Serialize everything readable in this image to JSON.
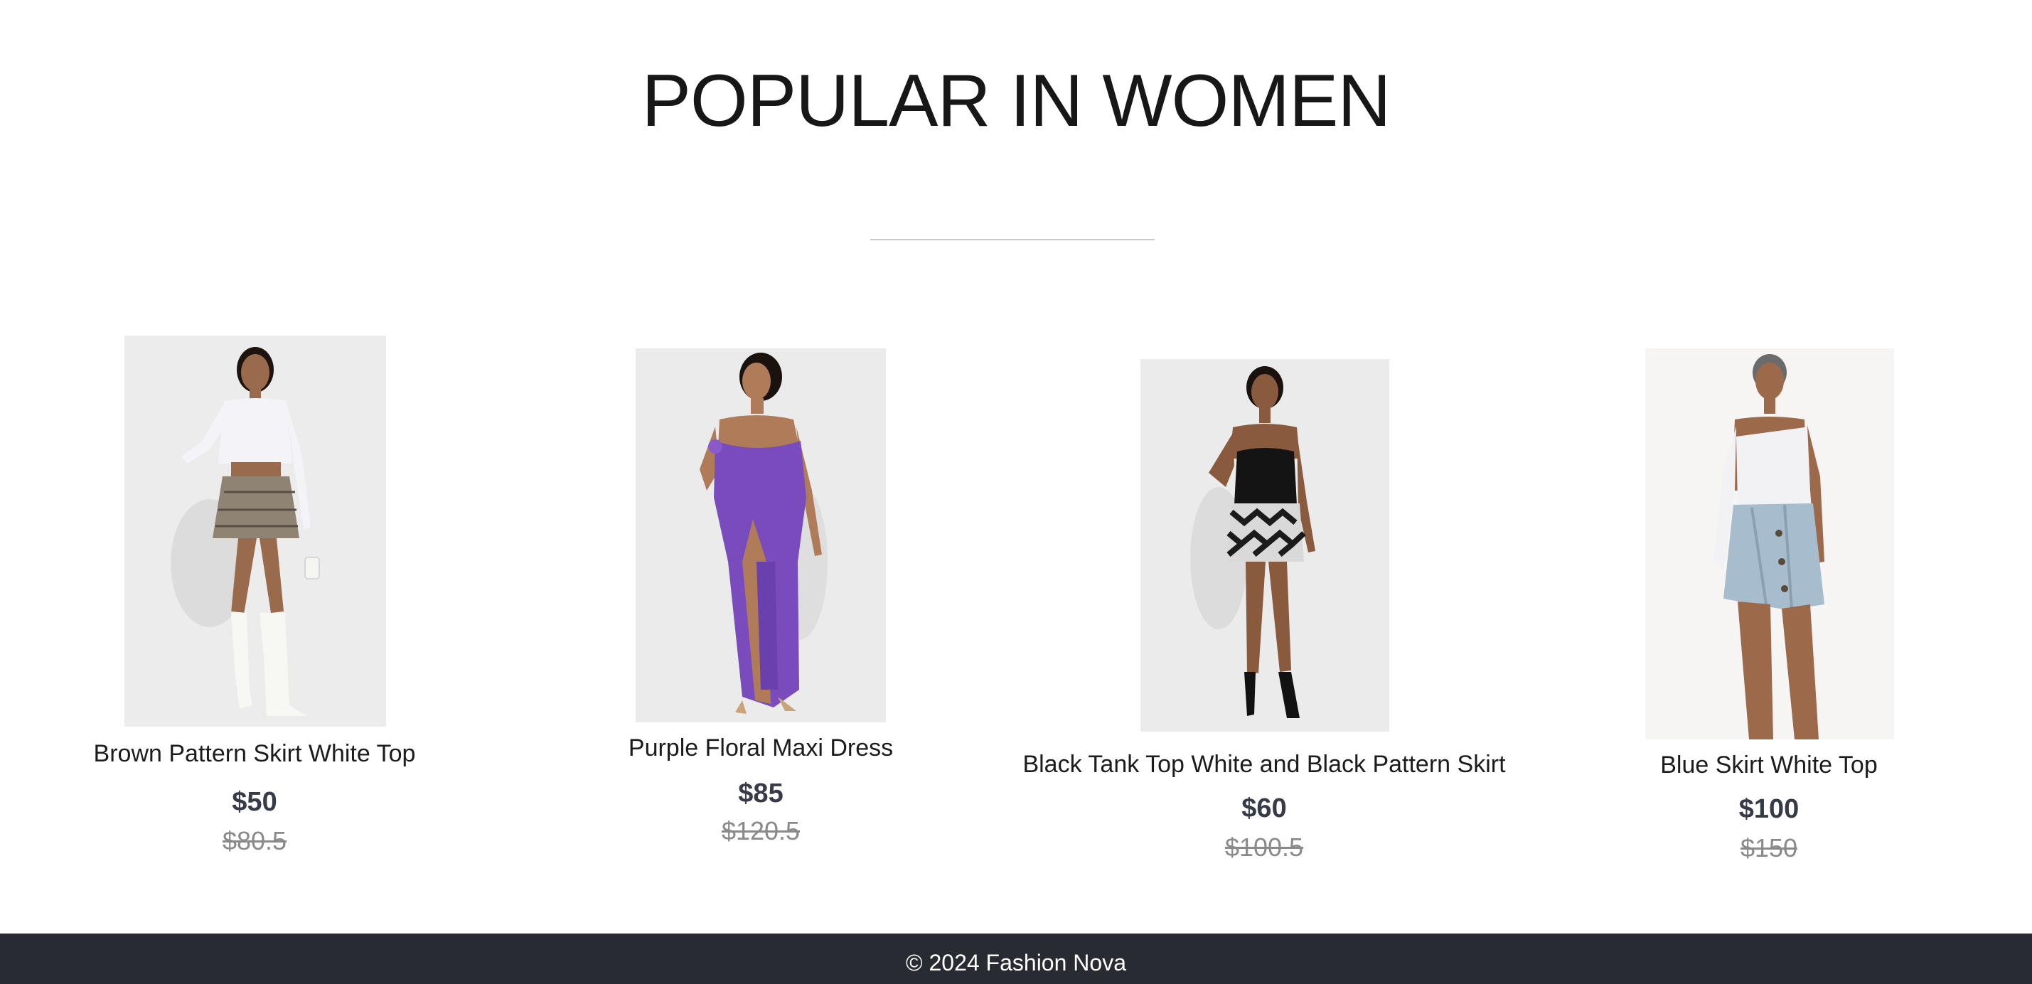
{
  "section": {
    "title": "POPULAR IN WOMEN"
  },
  "products": [
    {
      "name": "Brown Pattern Skirt White Top",
      "price": "$50",
      "old_price": "$80.5",
      "image": "product-photo-brown-pattern-skirt-white-top"
    },
    {
      "name": "Purple Floral Maxi Dress",
      "price": "$85",
      "old_price": "$120.5",
      "image": "product-photo-purple-floral-maxi-dress"
    },
    {
      "name": "Black Tank Top White and Black Pattern Skirt",
      "price": "$60",
      "old_price": "$100.5",
      "image": "product-photo-black-tank-top-pattern-skirt"
    },
    {
      "name": "Blue Skirt White Top",
      "price": "$100",
      "old_price": "$150",
      "image": "product-photo-blue-skirt-white-top"
    }
  ],
  "footer": {
    "copyright": "© 2024 Fashion Nova"
  },
  "colors": {
    "background": "#ffffff",
    "title": "#171717",
    "price": "#363b47",
    "old_price": "#8a8a8a",
    "footer_bg": "#282b32",
    "footer_text": "#ffffff"
  }
}
